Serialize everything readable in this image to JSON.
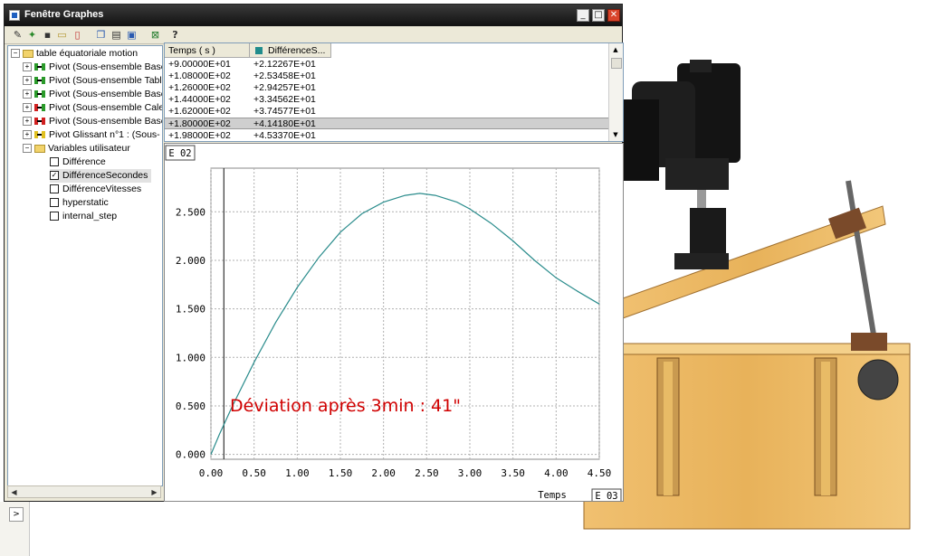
{
  "window": {
    "title": "Fenêtre Graphes",
    "minimize": "_",
    "maximize": "□",
    "close": "✕"
  },
  "toolbar": {
    "items": [
      {
        "icon": "pencil-icon",
        "glyph": "✎"
      },
      {
        "icon": "wand-icon",
        "glyph": "✦"
      },
      {
        "icon": "save-icon",
        "glyph": "▪"
      },
      {
        "icon": "open-folder-icon",
        "glyph": "▭"
      },
      {
        "icon": "new-document-icon",
        "glyph": "▯"
      },
      {
        "icon": "copy-icon",
        "glyph": "❐"
      },
      {
        "icon": "print-icon",
        "glyph": "▤"
      },
      {
        "icon": "settings-icon",
        "glyph": "▣"
      },
      {
        "icon": "excel-icon",
        "glyph": "⊠"
      },
      {
        "icon": "help-icon",
        "glyph": "?"
      }
    ]
  },
  "tree": {
    "root": "table équatoriale motion",
    "items": [
      {
        "label": "Pivot (Sous-ensemble Base",
        "kind": "green"
      },
      {
        "label": "Pivot (Sous-ensemble Tabl",
        "kind": "green"
      },
      {
        "label": "Pivot (Sous-ensemble Base",
        "kind": "green"
      },
      {
        "label": "Pivot (Sous-ensemble Cale",
        "kind": "red"
      },
      {
        "label": "Pivot (Sous-ensemble Base",
        "kind": "red"
      },
      {
        "label": "Pivot Glissant n°1 : (Sous-",
        "kind": "yellow"
      }
    ],
    "user_folder": "Variables utilisateur",
    "variables": [
      {
        "label": "Différence",
        "checked": false
      },
      {
        "label": "DifférenceSecondes",
        "checked": true
      },
      {
        "label": "DifférenceVitesses",
        "checked": false
      },
      {
        "label": "hyperstatic",
        "checked": false
      },
      {
        "label": "internal_step",
        "checked": false
      }
    ]
  },
  "table": {
    "headers": [
      "Temps ( s )",
      "DifférenceS..."
    ],
    "rows": [
      [
        "+9.00000E+01",
        "+2.12267E+01"
      ],
      [
        "+1.08000E+02",
        "+2.53458E+01"
      ],
      [
        "+1.26000E+02",
        "+2.94257E+01"
      ],
      [
        "+1.44000E+02",
        "+3.34562E+01"
      ],
      [
        "+1.62000E+02",
        "+3.74577E+01"
      ],
      [
        "+1.80000E+02",
        "+4.14180E+01"
      ],
      [
        "+1.98000E+02",
        "+4.53370E+01"
      ]
    ],
    "selected_row": 5
  },
  "chart_data": {
    "type": "line",
    "y_exponent_label": "E 02",
    "x_exponent_label": "E 03",
    "xlabel": "Temps",
    "xlim": [
      0.0,
      4.5
    ],
    "ylim": [
      -0.05,
      2.95
    ],
    "xticks": [
      "0.00",
      "0.50",
      "1.00",
      "1.50",
      "2.00",
      "2.50",
      "3.00",
      "3.50",
      "4.00",
      "4.50"
    ],
    "yticks": [
      "0.000",
      "0.500",
      "1.000",
      "1.500",
      "2.000",
      "2.500"
    ],
    "grid": true,
    "series": [
      {
        "color": "#2a8c8c",
        "x": [
          0.0,
          0.1,
          0.25,
          0.5,
          0.75,
          1.0,
          1.25,
          1.5,
          1.75,
          2.0,
          2.25,
          2.42,
          2.6,
          2.85,
          3.0,
          3.25,
          3.5,
          3.75,
          4.0,
          4.25,
          4.5
        ],
        "y": [
          0.0,
          0.21,
          0.5,
          0.95,
          1.36,
          1.72,
          2.03,
          2.29,
          2.48,
          2.6,
          2.67,
          2.69,
          2.67,
          2.6,
          2.53,
          2.38,
          2.2,
          2.0,
          1.82,
          1.68,
          1.55
        ]
      }
    ],
    "marker_x": 0.15,
    "annotation": "Déviation après 3min : 41\"",
    "annotation_color": "#d00000"
  }
}
